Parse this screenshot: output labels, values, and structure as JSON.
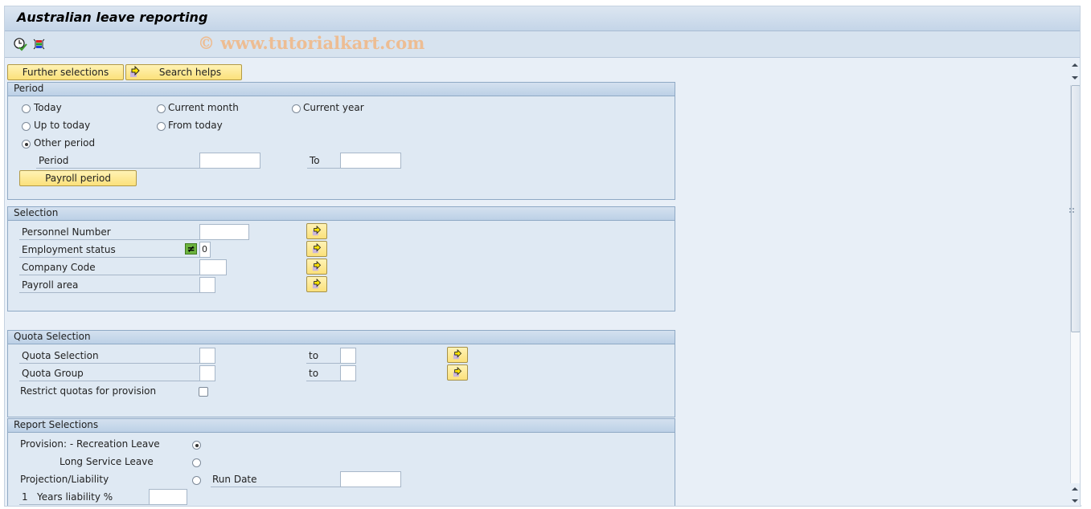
{
  "window": {
    "title": "Australian leave reporting",
    "watermark": "© www.tutorialkart.com"
  },
  "toolbar": {
    "icons": [
      "execute-clock-icon",
      "variant-selection-icon"
    ]
  },
  "buttons": {
    "further_selections": "Further selections",
    "search_helps": "Search helps",
    "payroll_period": "Payroll period"
  },
  "period": {
    "header": "Period",
    "options": [
      {
        "label": "Today",
        "selected": false
      },
      {
        "label": "Current month",
        "selected": false
      },
      {
        "label": "Current year",
        "selected": false
      },
      {
        "label": "Up to today",
        "selected": false
      },
      {
        "label": "From today",
        "selected": false
      },
      {
        "label": "Other period",
        "selected": true
      }
    ],
    "period_label": "Period",
    "period_from": "",
    "to_label": "To",
    "period_to": ""
  },
  "selection": {
    "header": "Selection",
    "rows": [
      {
        "label": "Personnel Number",
        "value": ""
      },
      {
        "label": "Employment status",
        "value": "0",
        "operator": "≠"
      },
      {
        "label": "Company Code",
        "value": ""
      },
      {
        "label": "Payroll area",
        "value": ""
      }
    ]
  },
  "quota": {
    "header": "Quota Selection",
    "rows": [
      {
        "label": "Quota Selection",
        "from": "",
        "to_label": "to",
        "to": ""
      },
      {
        "label": "Quota Group",
        "from": "",
        "to_label": "to",
        "to": ""
      }
    ],
    "restrict_label": "Restrict quotas for provision",
    "restrict_checked": false
  },
  "report": {
    "header": "Report Selections",
    "options": [
      {
        "label": "Provision: - Recreation Leave",
        "selected": true
      },
      {
        "label": "Long Service Leave",
        "selected": false
      },
      {
        "label": "Projection/Liability",
        "selected": false
      }
    ],
    "run_date_label": "Run Date",
    "run_date": "",
    "years_prefix": "1",
    "years_label": "Years liability %",
    "years_value": ""
  },
  "colors": {
    "button_yellow": "#fbe17a",
    "panel_bg": "#dfe9f3",
    "header_blue": "#bcd0e6"
  }
}
